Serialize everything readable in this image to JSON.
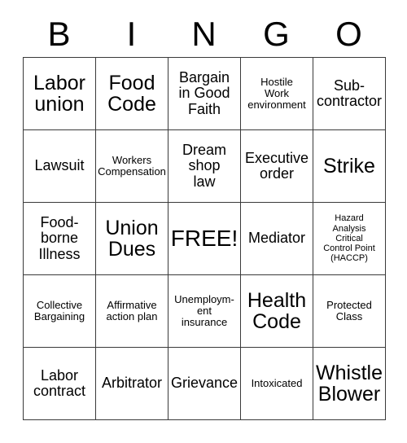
{
  "card": {
    "title": "BINGO",
    "header_letters": [
      "B",
      "I",
      "N",
      "G",
      "O"
    ],
    "free_space_label": "FREE!",
    "colors": {
      "background": "#ffffff",
      "text": "#000000",
      "grid_line": "#3a3a3a"
    },
    "rows": [
      [
        {
          "text": "Labor\nunion",
          "size": "lg"
        },
        {
          "text": "Food\nCode",
          "size": "lg"
        },
        {
          "text": "Bargain\nin Good\nFaith",
          "size": "md"
        },
        {
          "text": "Hostile\nWork\nenvironment",
          "size": "sm"
        },
        {
          "text": "Sub-\ncontractor",
          "size": "md"
        }
      ],
      [
        {
          "text": "Lawsuit",
          "size": "md"
        },
        {
          "text": "Workers\nCompensation",
          "size": "sm"
        },
        {
          "text": "Dream\nshop\nlaw",
          "size": "md"
        },
        {
          "text": "Executive\norder",
          "size": "md"
        },
        {
          "text": "Strike",
          "size": "lg"
        }
      ],
      [
        {
          "text": "Food-\nborne\nIllness",
          "size": "md"
        },
        {
          "text": "Union\nDues",
          "size": "lg"
        },
        {
          "text": "FREE!",
          "size": "xl"
        },
        {
          "text": "Mediator",
          "size": "md"
        },
        {
          "text": "Hazard\nAnalysis\nCritical\nControl Point\n(HACCP)",
          "size": "xs"
        }
      ],
      [
        {
          "text": "Collective\nBargaining",
          "size": "sm"
        },
        {
          "text": "Affirmative\naction plan",
          "size": "sm"
        },
        {
          "text": "Unemploym-\nent\ninsurance",
          "size": "sm"
        },
        {
          "text": "Health\nCode",
          "size": "lg"
        },
        {
          "text": "Protected\nClass",
          "size": "sm"
        }
      ],
      [
        {
          "text": "Labor\ncontract",
          "size": "md"
        },
        {
          "text": "Arbitrator",
          "size": "md"
        },
        {
          "text": "Grievance",
          "size": "md"
        },
        {
          "text": "Intoxicated",
          "size": "sm"
        },
        {
          "text": "Whistle\nBlower",
          "size": "lg"
        }
      ]
    ]
  }
}
